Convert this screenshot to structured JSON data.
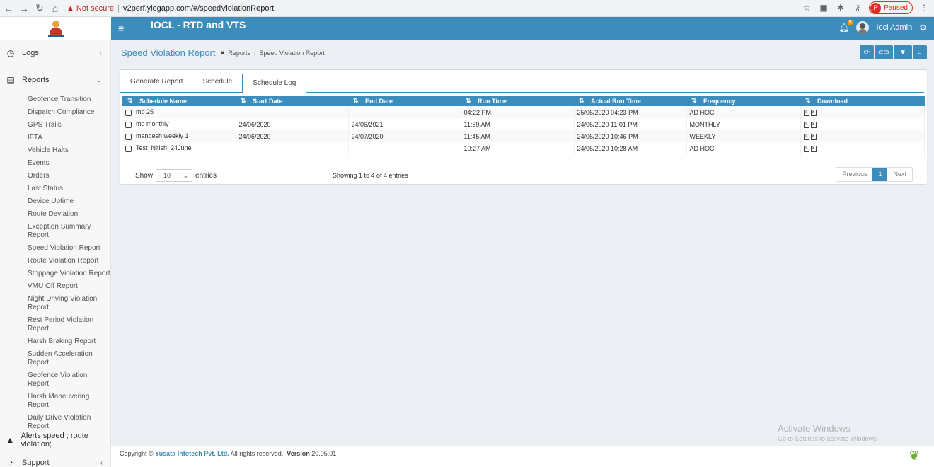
{
  "browser": {
    "not_secure": "Not secure",
    "url": "v2perf.ylogapp.com/#/speedViolationReport",
    "paused": "Paused",
    "profile_letter": "P"
  },
  "header": {
    "app_title": "IOCL - RTD and VTS",
    "notification_count": "8",
    "user_name": "Iocl Admin"
  },
  "sidebar": {
    "logs": "Logs",
    "reports": "Reports",
    "report_items": [
      "Geofence Transition",
      "Dispatch Compliance",
      "GPS Trails",
      "IFTA",
      "Vehicle Halts",
      "Events",
      "Orders",
      "Last Status",
      "Device Uptime",
      "Route Deviation",
      "Exception Summary Report",
      "Speed Violation Report",
      "Route Violation Report",
      "Stoppage Violation Report",
      "VMU Off Report",
      "Night Driving Violation Report",
      "Rest Period Violation Report",
      "Harsh Braking Report",
      "Sudden Acceleration Report",
      "Geofence Violation Report",
      "Harsh Maneuvering Report",
      "Daily Drive Violation Report"
    ],
    "alerts": "Alerts speed ; route violation;",
    "support": "Support"
  },
  "page": {
    "title": "Speed Violation Report",
    "breadcrumb": [
      "Reports",
      "Speed Violation Report"
    ]
  },
  "tabs": [
    "Generate Report",
    "Schedule",
    "Schedule Log"
  ],
  "table": {
    "columns": [
      "Schedule Name",
      "Start Date",
      "End Date",
      "Run Time",
      "Actual Run Time",
      "Frequency",
      "Download"
    ],
    "rows": [
      [
        "md 25",
        "",
        "",
        "04:22 PM",
        "25/06/2020 04:23 PM",
        "AD HOC"
      ],
      [
        "md monthly",
        "24/06/2020",
        "24/06/2021",
        "11:59 AM",
        "24/06/2020 11:01 PM",
        "MONTHLY"
      ],
      [
        "mangesh weekly 1",
        "24/06/2020",
        "24/07/2020",
        "11:45 AM",
        "24/06/2020 10:46 PM",
        "WEEKLY"
      ],
      [
        "Test_Nitish_24June",
        "",
        "",
        "10:27 AM",
        "24/06/2020 10:28 AM",
        "AD HOC"
      ]
    ]
  },
  "table_footer": {
    "show": "Show",
    "page_length": "10",
    "entries": "entries",
    "info": "Showing 1 to 4 of 4 entries",
    "previous": "Previous",
    "current_page": "1",
    "next": "Next"
  },
  "footer": {
    "copyright": "Copyright ©",
    "company": "Yusata Infotech Pvt. Ltd.",
    "rights": "All rights reserved.",
    "version_label": "Version",
    "version": "20.05.01"
  },
  "watermark": {
    "line1": "Activate Windows",
    "line2": "Go to Settings to activate Windows."
  }
}
